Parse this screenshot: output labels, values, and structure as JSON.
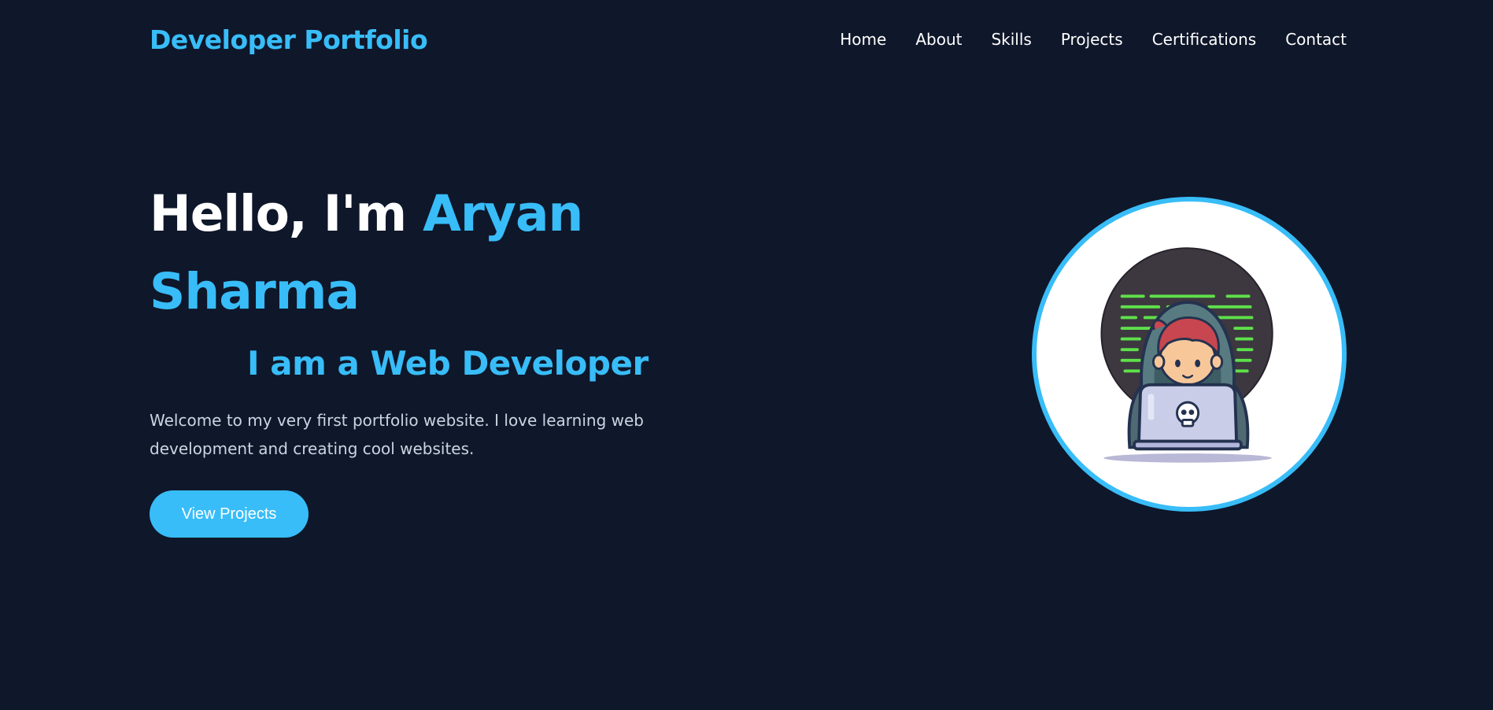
{
  "header": {
    "logo": "Developer Portfolio",
    "nav": [
      "Home",
      "About",
      "Skills",
      "Projects",
      "Certifications",
      "Contact"
    ]
  },
  "hero": {
    "greeting": "Hello, I'm ",
    "name": "Aryan Sharma",
    "typed_role": "I am a Web Developer",
    "intro": "Welcome to my very first portfolio website. I love learning web development and creating cool websites.",
    "cta_label": "View Projects"
  },
  "avatar": {
    "icon": "hooded-coder-with-laptop-illustration"
  },
  "colors": {
    "background": "#0f172a",
    "accent": "#38bdf8",
    "text": "#ffffff",
    "muted": "#cbd5e1"
  }
}
